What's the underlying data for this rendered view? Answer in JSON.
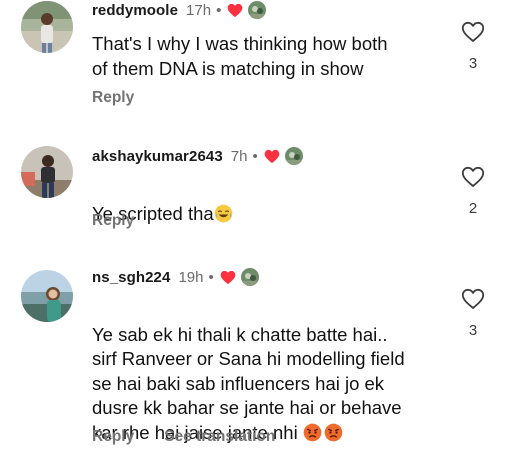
{
  "comments": [
    {
      "username": "reddymoole",
      "time": "17h",
      "dot": "•",
      "text": "That's I why I was thinking how both\nof them DNA is matching in show",
      "likes": "3",
      "reply_label": "Reply"
    },
    {
      "username": "akshaykumar2643",
      "time": "7h",
      "dot": "•",
      "text": "Ye scripted tha",
      "emoji": "😂",
      "likes": "2",
      "reply_label": "Reply"
    },
    {
      "username": "ns_sgh224",
      "time": "19h",
      "dot": "•",
      "text": "Ye sab ek hi thali k chatte batte hai..\nsirf Ranveer or Sana hi modelling field\nse hai baki sab influencers hai jo ek\ndusre kk bahar se jante hai or behave\nkar rhe hai jaise jante nhi ",
      "emoji": "😡😡",
      "likes": "3",
      "reply_label": "Reply",
      "translate_label": "See translation"
    }
  ],
  "icons": {
    "creator_heart": "heart-filled-icon",
    "like": "heart-outline-icon",
    "emoji_laugh": "face-with-tears-of-joy-emoji",
    "emoji_angry": "angry-face-emoji"
  },
  "colors": {
    "heart_red": "#ff3040",
    "secondary_text": "#737373"
  }
}
